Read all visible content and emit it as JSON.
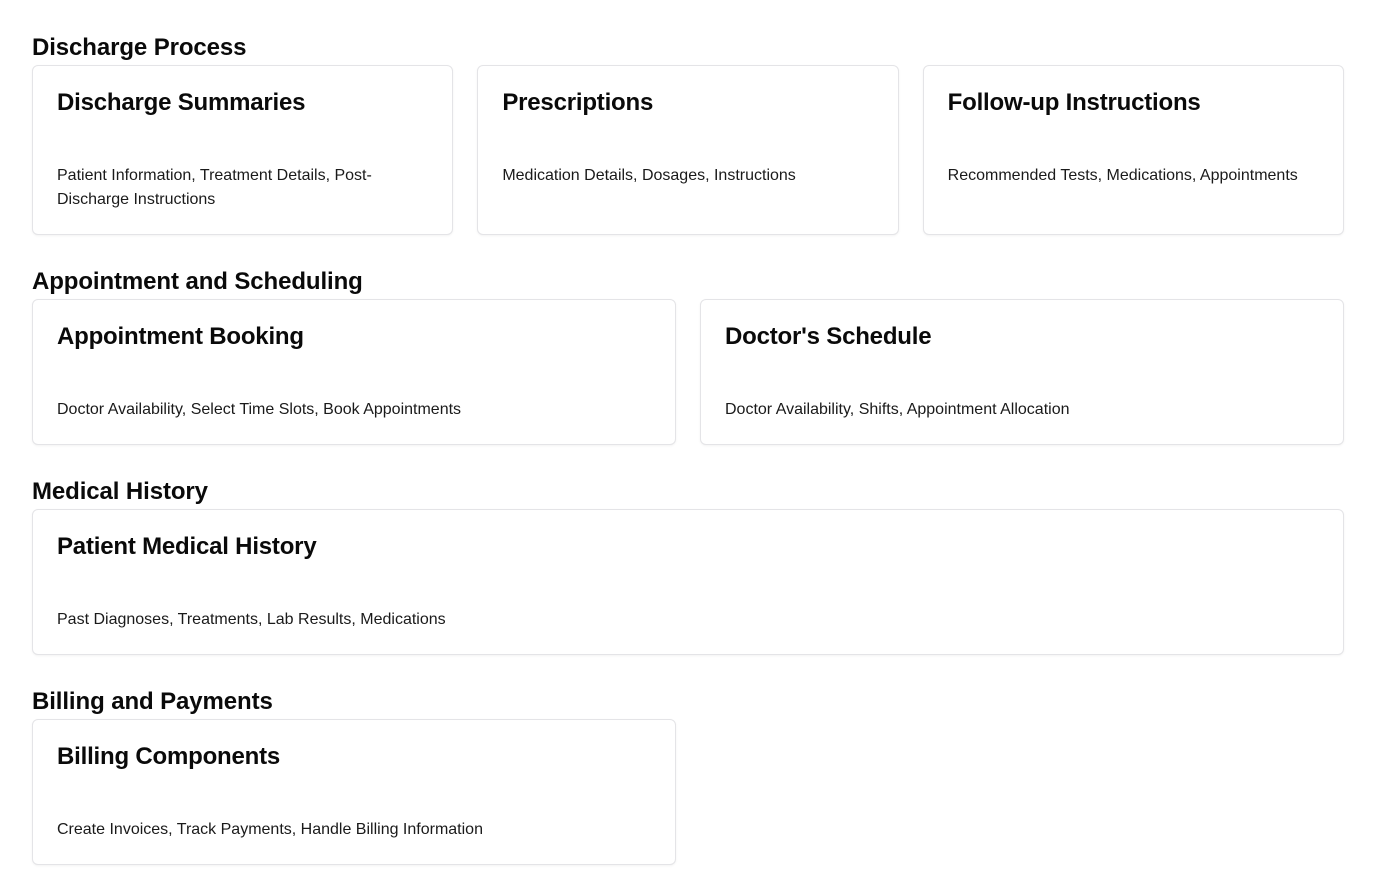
{
  "sections": [
    {
      "title": "Discharge Process",
      "cards": [
        {
          "title": "Discharge Summaries",
          "description": "Patient Information, Treatment Details, Post-Discharge Instructions"
        },
        {
          "title": "Prescriptions",
          "description": "Medication Details, Dosages, Instructions"
        },
        {
          "title": "Follow-up Instructions",
          "description": "Recommended Tests, Medications, Appointments"
        }
      ]
    },
    {
      "title": "Appointment and Scheduling",
      "cards": [
        {
          "title": "Appointment Booking",
          "description": "Doctor Availability, Select Time Slots, Book Appointments"
        },
        {
          "title": "Doctor's Schedule",
          "description": "Doctor Availability, Shifts, Appointment Allocation"
        }
      ]
    },
    {
      "title": "Medical History",
      "cards": [
        {
          "title": "Patient Medical History",
          "description": "Past Diagnoses, Treatments, Lab Results, Medications"
        }
      ]
    },
    {
      "title": "Billing and Payments",
      "cards": [
        {
          "title": "Billing Components",
          "description": "Create Invoices, Track Payments, Handle Billing Information"
        }
      ]
    }
  ]
}
